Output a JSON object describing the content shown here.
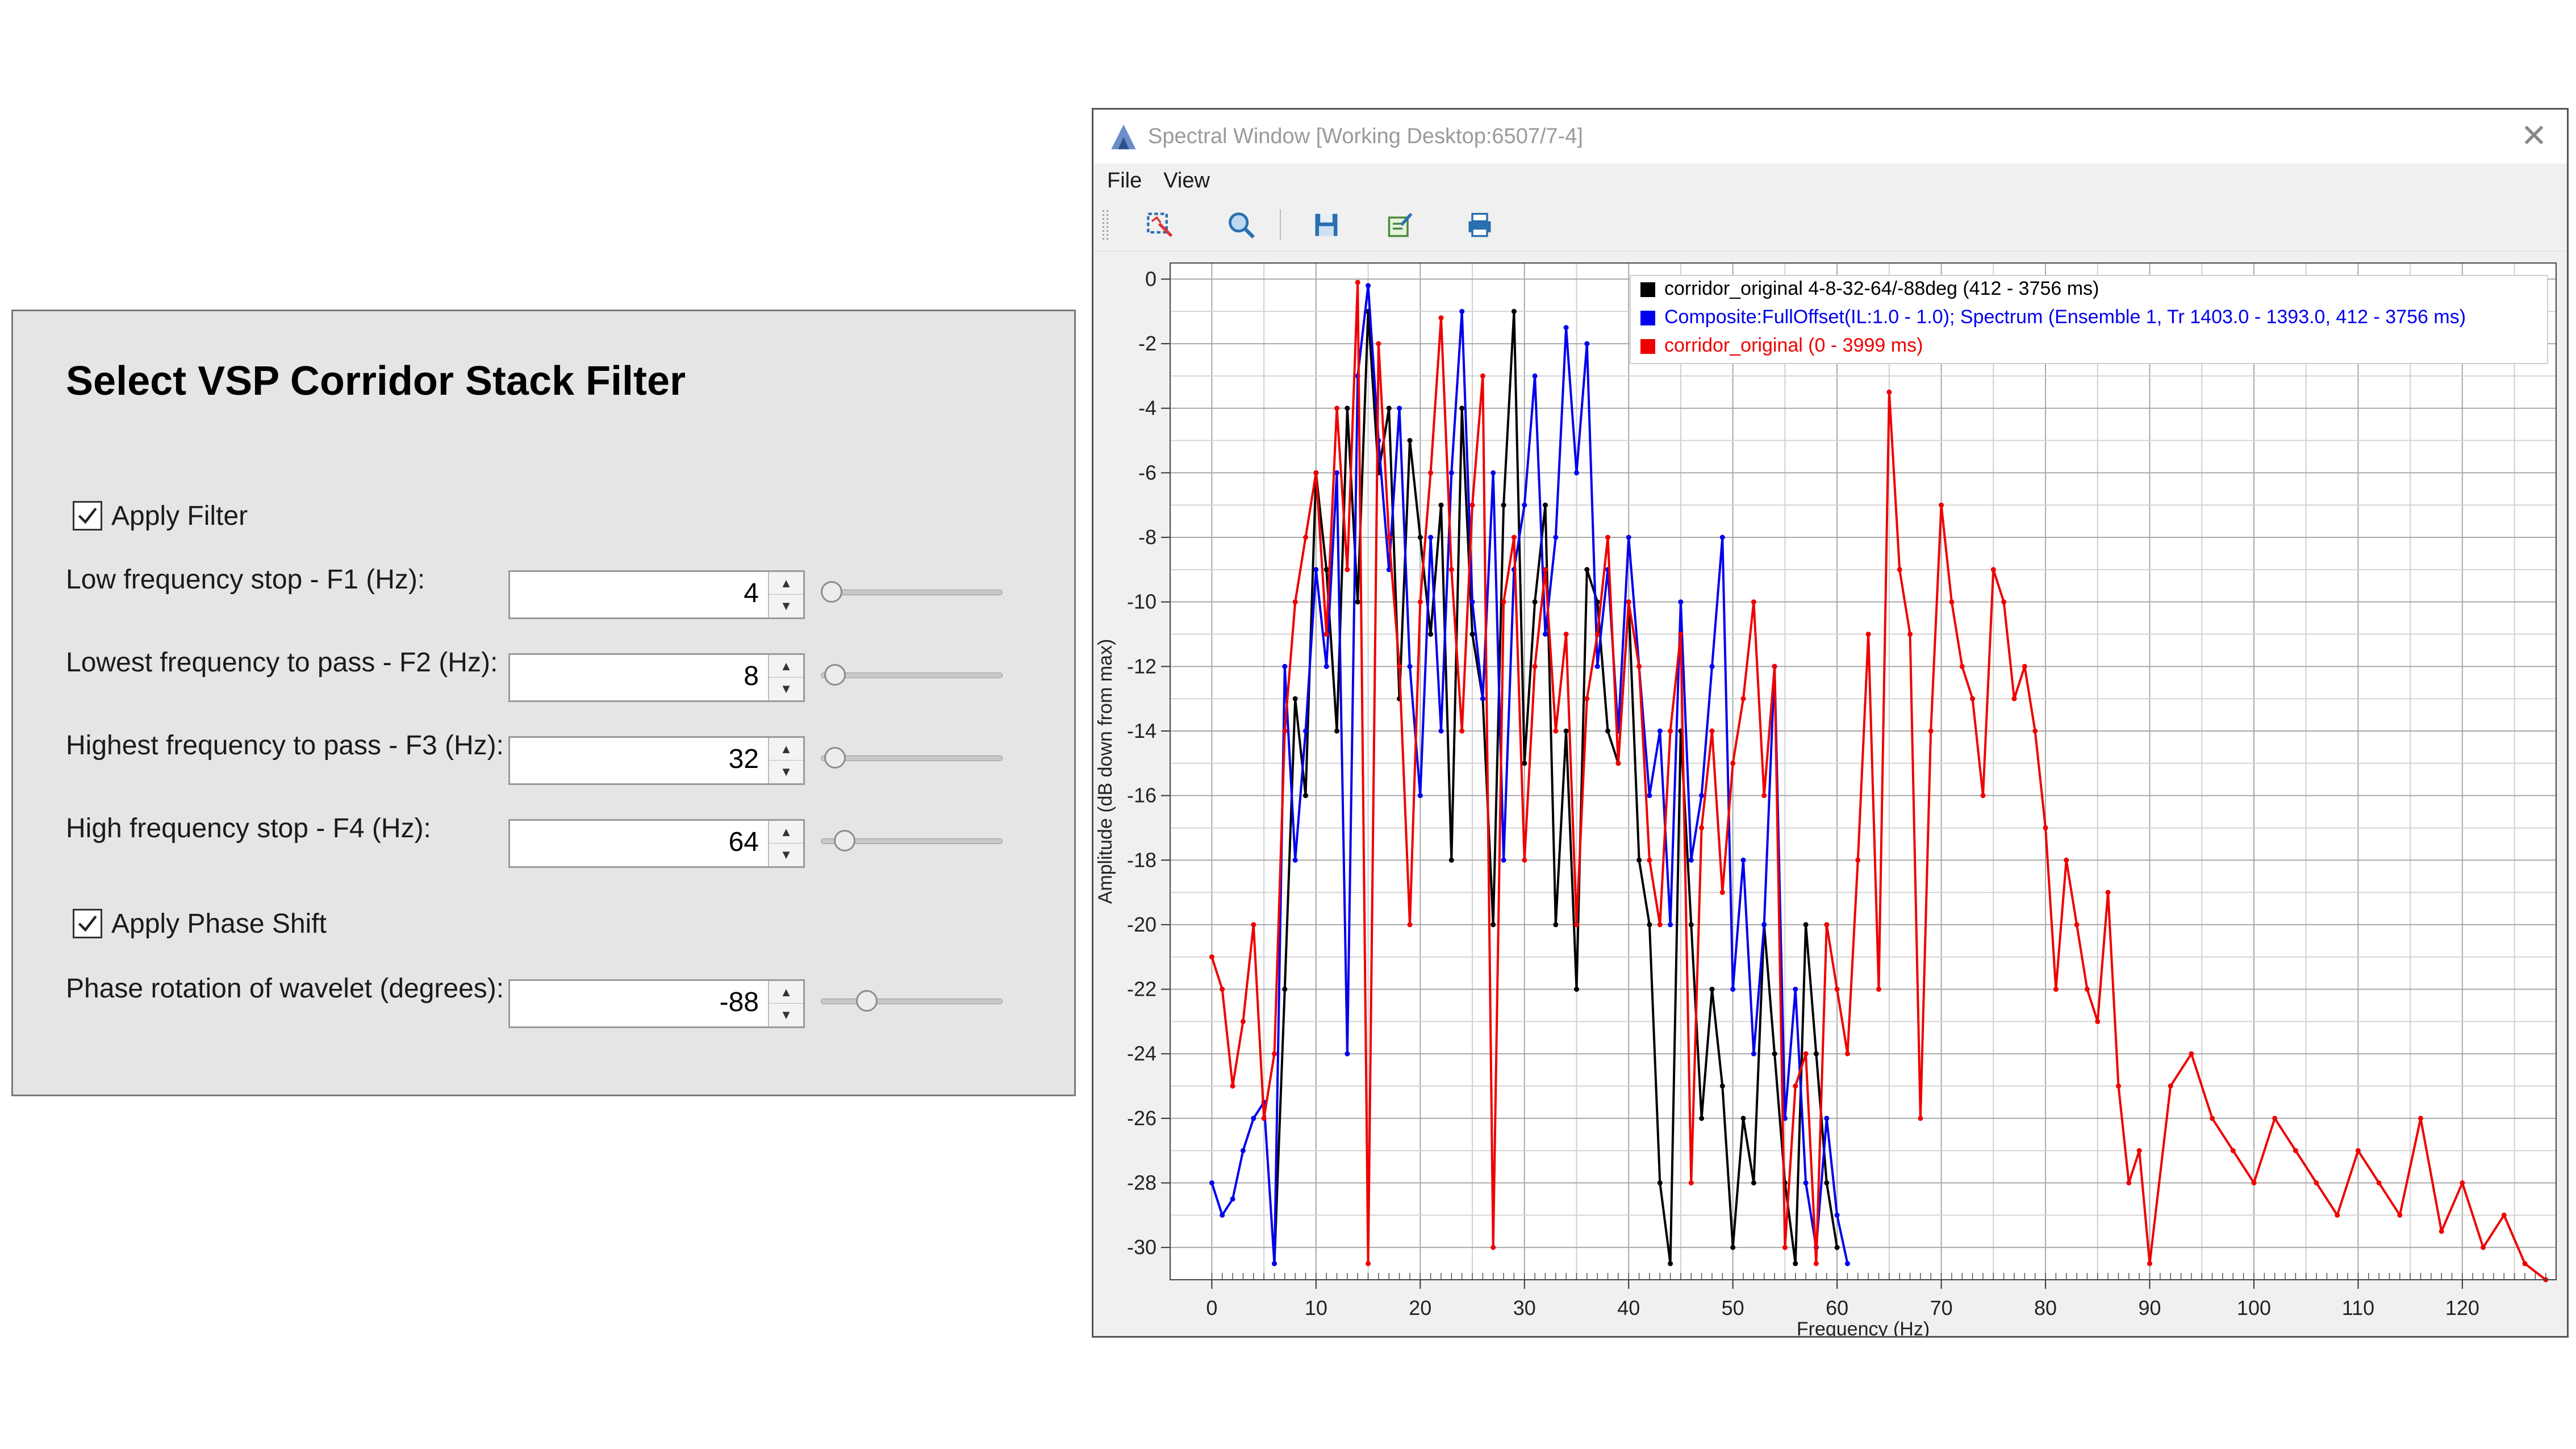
{
  "filter_dialog": {
    "title": "Select VSP Corridor Stack Filter",
    "apply_filter": {
      "label": "Apply Filter",
      "checked": true
    },
    "apply_phase_shift": {
      "label": "Apply Phase Shift",
      "checked": true
    },
    "params": [
      {
        "id": "f1",
        "label": "Low frequency stop - F1 (Hz):",
        "value": "4",
        "slider_fraction": 0.0
      },
      {
        "id": "f2",
        "label": "Lowest frequency to pass - F2 (Hz):",
        "value": "8",
        "slider_fraction": 0.02
      },
      {
        "id": "f3",
        "label": "Highest frequency to pass - F3 (Hz):",
        "value": "32",
        "slider_fraction": 0.02
      },
      {
        "id": "f4",
        "label": "High frequency stop - F4 (Hz):",
        "value": "64",
        "slider_fraction": 0.08
      },
      {
        "id": "phase",
        "label": "Phase rotation of wavelet (degrees):",
        "value": "-88",
        "slider_fraction": 0.22
      }
    ]
  },
  "spectral_window": {
    "title": "Spectral Window [Working Desktop:6507/7-4]",
    "menu": [
      "File",
      "View"
    ],
    "toolbar": [
      "zoom-box-icon",
      "zoom-icon",
      "save-icon",
      "edit-icon",
      "print-icon"
    ],
    "close_glyph": "✕"
  },
  "chart_data": {
    "type": "line",
    "xlabel": "Frequency (Hz)",
    "ylabel": "Amplitude (dB down from max)",
    "xlim": [
      -4,
      129
    ],
    "ylim": [
      -31,
      0.5
    ],
    "xticks": [
      0,
      10,
      20,
      30,
      40,
      50,
      60,
      70,
      80,
      90,
      100,
      110,
      120
    ],
    "yticks": [
      0,
      -2,
      -4,
      -6,
      -8,
      -10,
      -12,
      -14,
      -16,
      -18,
      -20,
      -22,
      -24,
      -26,
      -28,
      -30
    ],
    "grid": true,
    "legend_position": "top-right",
    "series": [
      {
        "name": "corridor_original 4-8-32-64/-88deg (412 - 3756 ms)",
        "color": "#000000",
        "x": [
          6,
          7,
          8,
          9,
          10,
          11,
          12,
          13,
          14,
          15,
          16,
          17,
          18,
          19,
          20,
          21,
          22,
          23,
          24,
          25,
          26,
          27,
          28,
          29,
          30,
          31,
          32,
          33,
          34,
          35,
          36,
          37,
          38,
          39,
          40,
          41,
          42,
          43,
          44,
          45,
          46,
          47,
          48,
          49,
          50,
          51,
          52,
          53,
          54,
          55,
          56,
          57,
          58,
          59,
          60
        ],
        "y": [
          -30.5,
          -22,
          -13,
          -16,
          -6,
          -9,
          -14,
          -4,
          -10,
          -1,
          -6,
          -4,
          -13,
          -5,
          -8,
          -11,
          -7,
          -18,
          -4,
          -11,
          -13,
          -20,
          -7,
          -1,
          -15,
          -10,
          -7,
          -20,
          -14,
          -22,
          -9,
          -10,
          -14,
          -15,
          -10,
          -18,
          -20,
          -28,
          -30.5,
          -14,
          -20,
          -26,
          -22,
          -25,
          -30,
          -26,
          -28,
          -20,
          -24,
          -28,
          -30.5,
          -20,
          -24,
          -28,
          -30
        ]
      },
      {
        "name": "Composite:FullOffset(IL:1.0 - 1.0); Spectrum (Ensemble 1, Tr 1403.0 - 1393.0, 412 - 3756 ms)",
        "color": "#0000ee",
        "x": [
          0,
          1,
          2,
          3,
          4,
          5,
          6,
          7,
          8,
          9,
          10,
          11,
          12,
          13,
          14,
          15,
          16,
          17,
          18,
          19,
          20,
          21,
          22,
          23,
          24,
          25,
          26,
          27,
          28,
          29,
          30,
          31,
          32,
          33,
          34,
          35,
          36,
          37,
          38,
          39,
          40,
          41,
          42,
          43,
          44,
          45,
          46,
          47,
          48,
          49,
          50,
          51,
          52,
          53,
          54,
          55,
          56,
          57,
          58,
          59,
          60,
          61
        ],
        "y": [
          -28,
          -29,
          -28.5,
          -27,
          -26,
          -25.5,
          -30.5,
          -12,
          -18,
          -14,
          -9,
          -12,
          -6,
          -24,
          -3,
          -0.2,
          -5,
          -9,
          -4,
          -12,
          -16,
          -8,
          -14,
          -6,
          -1,
          -10,
          -13,
          -6,
          -18,
          -9,
          -7,
          -3,
          -11,
          -8,
          -1.5,
          -6,
          -2,
          -12,
          -9,
          -14,
          -8,
          -12,
          -16,
          -14,
          -20,
          -10,
          -18,
          -16,
          -12,
          -8,
          -22,
          -18,
          -24,
          -20,
          -12,
          -26,
          -22,
          -28,
          -30,
          -26,
          -29,
          -30.5
        ]
      },
      {
        "name": "corridor_original (0 - 3999 ms)",
        "color": "#ee0000",
        "x": [
          0,
          1,
          2,
          3,
          4,
          5,
          6,
          7,
          8,
          9,
          10,
          11,
          12,
          13,
          14,
          15,
          16,
          17,
          18,
          19,
          20,
          21,
          22,
          23,
          24,
          25,
          26,
          27,
          28,
          29,
          30,
          31,
          32,
          33,
          34,
          35,
          36,
          37,
          38,
          39,
          40,
          41,
          42,
          43,
          44,
          45,
          46,
          47,
          48,
          49,
          50,
          51,
          52,
          53,
          54,
          55,
          56,
          57,
          58,
          59,
          60,
          61,
          62,
          63,
          64,
          65,
          66,
          67,
          68,
          69,
          70,
          71,
          72,
          73,
          74,
          75,
          76,
          77,
          78,
          79,
          80,
          81,
          82,
          83,
          84,
          85,
          86,
          87,
          88,
          89,
          90,
          92,
          94,
          96,
          98,
          100,
          102,
          104,
          106,
          108,
          110,
          112,
          114,
          116,
          118,
          120,
          122,
          124,
          126,
          128
        ],
        "y": [
          -21,
          -22,
          -25,
          -23,
          -20,
          -26,
          -24,
          -14,
          -10,
          -8,
          -6,
          -11,
          -4,
          -9,
          -0.1,
          -30.5,
          -2,
          -8,
          -12,
          -20,
          -10,
          -6,
          -1.2,
          -9,
          -14,
          -7,
          -3,
          -30,
          -10,
          -8,
          -18,
          -12,
          -9,
          -14,
          -11,
          -20,
          -13,
          -11,
          -8,
          -15,
          -10,
          -12,
          -18,
          -20,
          -14,
          -11,
          -28,
          -17,
          -14,
          -19,
          -15,
          -13,
          -10,
          -16,
          -12,
          -30,
          -25,
          -24,
          -30.5,
          -20,
          -22,
          -24,
          -18,
          -11,
          -22,
          -3.5,
          -9,
          -11,
          -26,
          -14,
          -7,
          -10,
          -12,
          -13,
          -16,
          -9,
          -10,
          -13,
          -12,
          -14,
          -17,
          -22,
          -18,
          -20,
          -22,
          -23,
          -19,
          -25,
          -28,
          -27,
          -30.5,
          -25,
          -24,
          -26,
          -27,
          -28,
          -26,
          -27,
          -28,
          -29,
          -27,
          -28,
          -29,
          -26,
          -29.5,
          -28,
          -30,
          -29,
          -30.5,
          -31
        ]
      }
    ]
  }
}
